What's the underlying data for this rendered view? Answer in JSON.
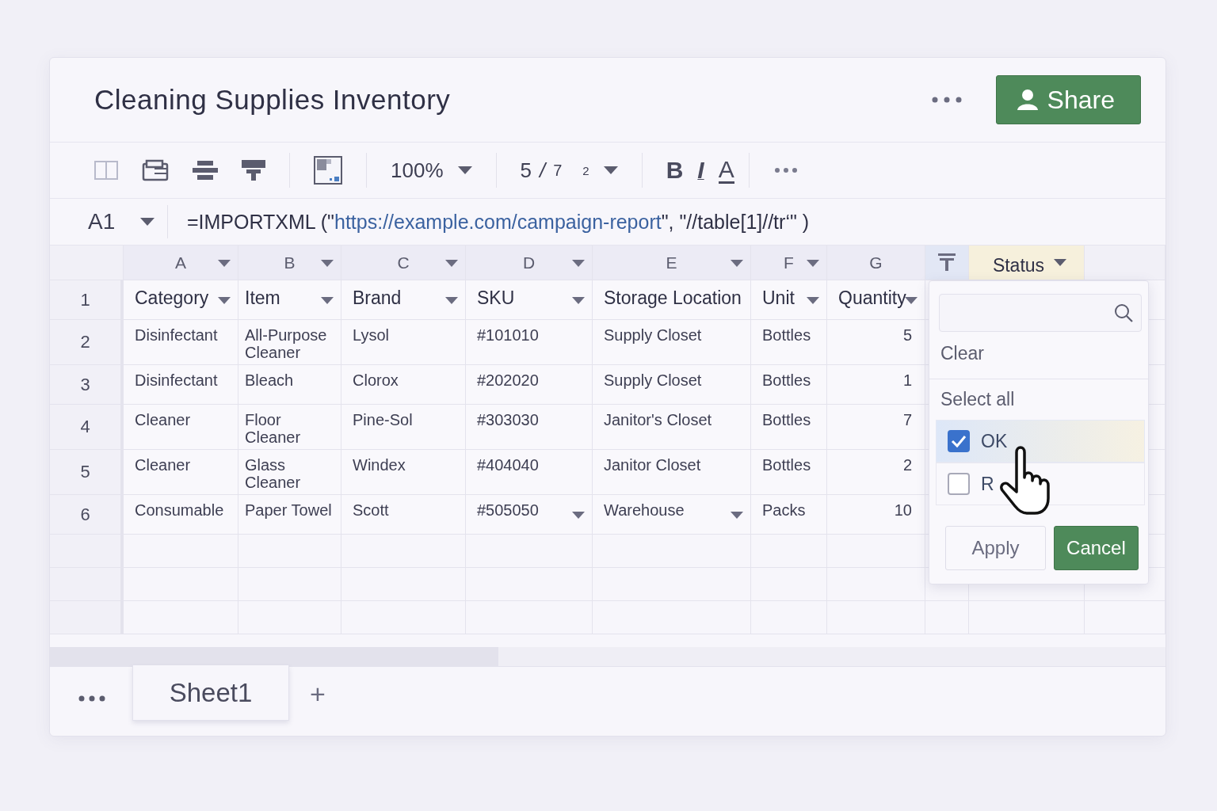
{
  "title": "Cleaning Supplies Inventory",
  "share": "Share",
  "toolbar": {
    "zoom": "100%",
    "font_size": [
      "5",
      "/",
      "7",
      "2"
    ],
    "bold": "B",
    "italic": "I",
    "font_color_button": "A"
  },
  "formula_bar": {
    "cell": "A1",
    "before": "=IMPORTXML (\"",
    "link": "https://example.com/campaign-report",
    "after": "\", \"//table[1]//tr‘\" )"
  },
  "columns": [
    {
      "letter": "A",
      "dropdown": true
    },
    {
      "letter": "B",
      "dropdown": true
    },
    {
      "letter": "C",
      "dropdown": true
    },
    {
      "letter": "D",
      "dropdown": true
    },
    {
      "letter": "E",
      "dropdown": true
    },
    {
      "letter": "F",
      "dropdown": true
    },
    {
      "letter": "G",
      "dropdown": false
    }
  ],
  "filter_column": {
    "label": "Status",
    "dropdown": true
  },
  "rows": [
    {
      "number": "1",
      "header": true,
      "cells": [
        "Category",
        "Item",
        "Brand",
        "SKU",
        "Storage Location",
        "Unit",
        "Quantity"
      ],
      "dropdowns": [
        true,
        true,
        true,
        true,
        false,
        true,
        true
      ]
    },
    {
      "number": "2",
      "header": false,
      "cells": [
        "Disinfectant",
        "All-Purpose Cleaner",
        "Lysol",
        "#101010",
        "Supply Closet",
        "Bottles",
        "5"
      ],
      "dropdowns": [
        false,
        false,
        false,
        false,
        false,
        false,
        false
      ]
    },
    {
      "number": "3",
      "header": false,
      "cells": [
        "Disinfectant",
        "Bleach",
        "Clorox",
        "#202020",
        "Supply Closet",
        "Bottles",
        "1"
      ],
      "dropdowns": [
        false,
        false,
        false,
        false,
        false,
        false,
        false
      ]
    },
    {
      "number": "4",
      "header": false,
      "cells": [
        "Cleaner",
        "Floor Cleaner",
        "Pine-Sol",
        "#303030",
        "Janitor's Closet",
        "Bottles",
        "7"
      ],
      "dropdowns": [
        false,
        false,
        false,
        false,
        false,
        false,
        false
      ]
    },
    {
      "number": "5",
      "header": false,
      "cells": [
        "Cleaner",
        "Glass Cleaner",
        "Windex",
        "#404040",
        "Janitor Closet",
        "Bottles",
        "2"
      ],
      "dropdowns": [
        false,
        false,
        false,
        false,
        false,
        false,
        false
      ]
    },
    {
      "number": "6",
      "header": false,
      "cells": [
        "Consumable",
        "Paper Towel",
        "Scott",
        "#505050",
        "Warehouse",
        "Packs",
        "10"
      ],
      "dropdowns": [
        false,
        false,
        false,
        true,
        true,
        false,
        false
      ]
    }
  ],
  "filter_menu": {
    "clear": "Clear",
    "select_all": "Select all",
    "options": [
      {
        "label": "OK",
        "checked": true,
        "selected": true
      },
      {
        "label": "R",
        "checked": false,
        "selected": false
      }
    ],
    "apply": "Apply",
    "cancel": "Cancel"
  },
  "sheets": [
    {
      "name": "Sheet1",
      "selected": true
    }
  ],
  "add_sheet": "+"
}
